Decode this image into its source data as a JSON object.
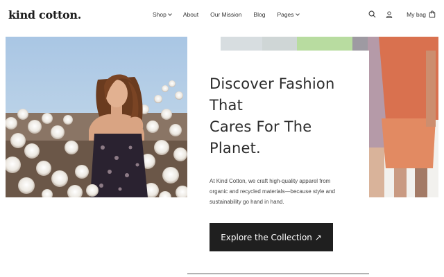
{
  "header": {
    "logo": "kind cotton.",
    "nav": [
      {
        "label": "Shop",
        "dropdown": true
      },
      {
        "label": "About",
        "dropdown": false
      },
      {
        "label": "Our Mission",
        "dropdown": false
      },
      {
        "label": "Blog",
        "dropdown": false
      },
      {
        "label": "Pages",
        "dropdown": true
      }
    ],
    "icons": [
      "search-icon",
      "user-icon",
      "shopping-bag-icon"
    ],
    "bag_label": "My bag"
  },
  "hero": {
    "headline_lines": [
      "Discover Fashion",
      "That",
      "Cares For The",
      "Planet."
    ],
    "description": "At Kind Cotton, we craft high-quality apparel from organic and recycled materials—because style and sustainability go hand in hand.",
    "cta_label": "Explore the Collection ↗"
  },
  "colors": {
    "button_bg": "#1f1f1f",
    "button_text": "#ffffff",
    "text": "#2a2a2a"
  }
}
